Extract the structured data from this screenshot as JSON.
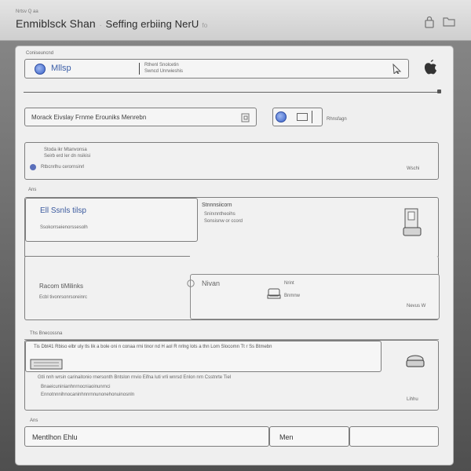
{
  "header": {
    "crumb": "Nrtsv Q aa",
    "title_main": "Enmiblsck Shan",
    "title_sep": "·",
    "title_sub": "Seffing erbiing NerU",
    "title_tiny": "fo"
  },
  "account": {
    "label": "Coniseuncnd",
    "value": "Mllsp",
    "info_line1": "Rthenl Snolcetin",
    "info_line2": "Swncd Unrwieshis"
  },
  "menu_select": {
    "value": "Morack Eivslay Frnme Erouniks Menrebn",
    "toggle_label": "Rhnsfagn"
  },
  "section1": {
    "line1": "Stoda ikr Mtanvonsa",
    "line2": "Seirb erd ler dn nsikisi",
    "line3": "Rtbcnrlhu cerornsinrl",
    "corner": "Wschi"
  },
  "section2": {
    "heading": "Ans",
    "left_title": "Ell Ssnls tilsp",
    "left_sub": "Ssokorrseienorssesolh",
    "right_title": "Stnnnsiicorn",
    "right_line1": "Snirxnntheoihs",
    "right_line2": "Sonsisnw or ccord"
  },
  "section3": {
    "left_title": "Racom tiMilinks",
    "left_sub": "Ecbl tivonrsonrsoreinrc",
    "center_label": "Nivan",
    "right_line1": "Nrint",
    "right_line2": "Bnmnw",
    "corner": "Nevus W"
  },
  "section4": {
    "heading": "Ths Bnecossna",
    "banner": "Tis Dbt41 Rbiso elbr uly tls lik a bole oni n conaa rmi tinor nd H aol R nrlng lots a thn Lom Slocomn Tt r Ss Btmebn",
    "body_line1": "Gtli nnh wrsin carinaitonio rnersonth Bntslon rnvio Eifna luti vrli wnrsd Enlon nrn Csstnrte Tiel",
    "body_line2": "Bnaeicuninianhnrnocniaoinunrnci",
    "body_line3": "Ennotnnnihnocaninhnnrnnunonehonuinosnln",
    "corner": "Lihhu"
  },
  "footer": {
    "label": "Ans",
    "field1": "Mentlhon Ehlu",
    "field2": "Men",
    "field3": ""
  }
}
